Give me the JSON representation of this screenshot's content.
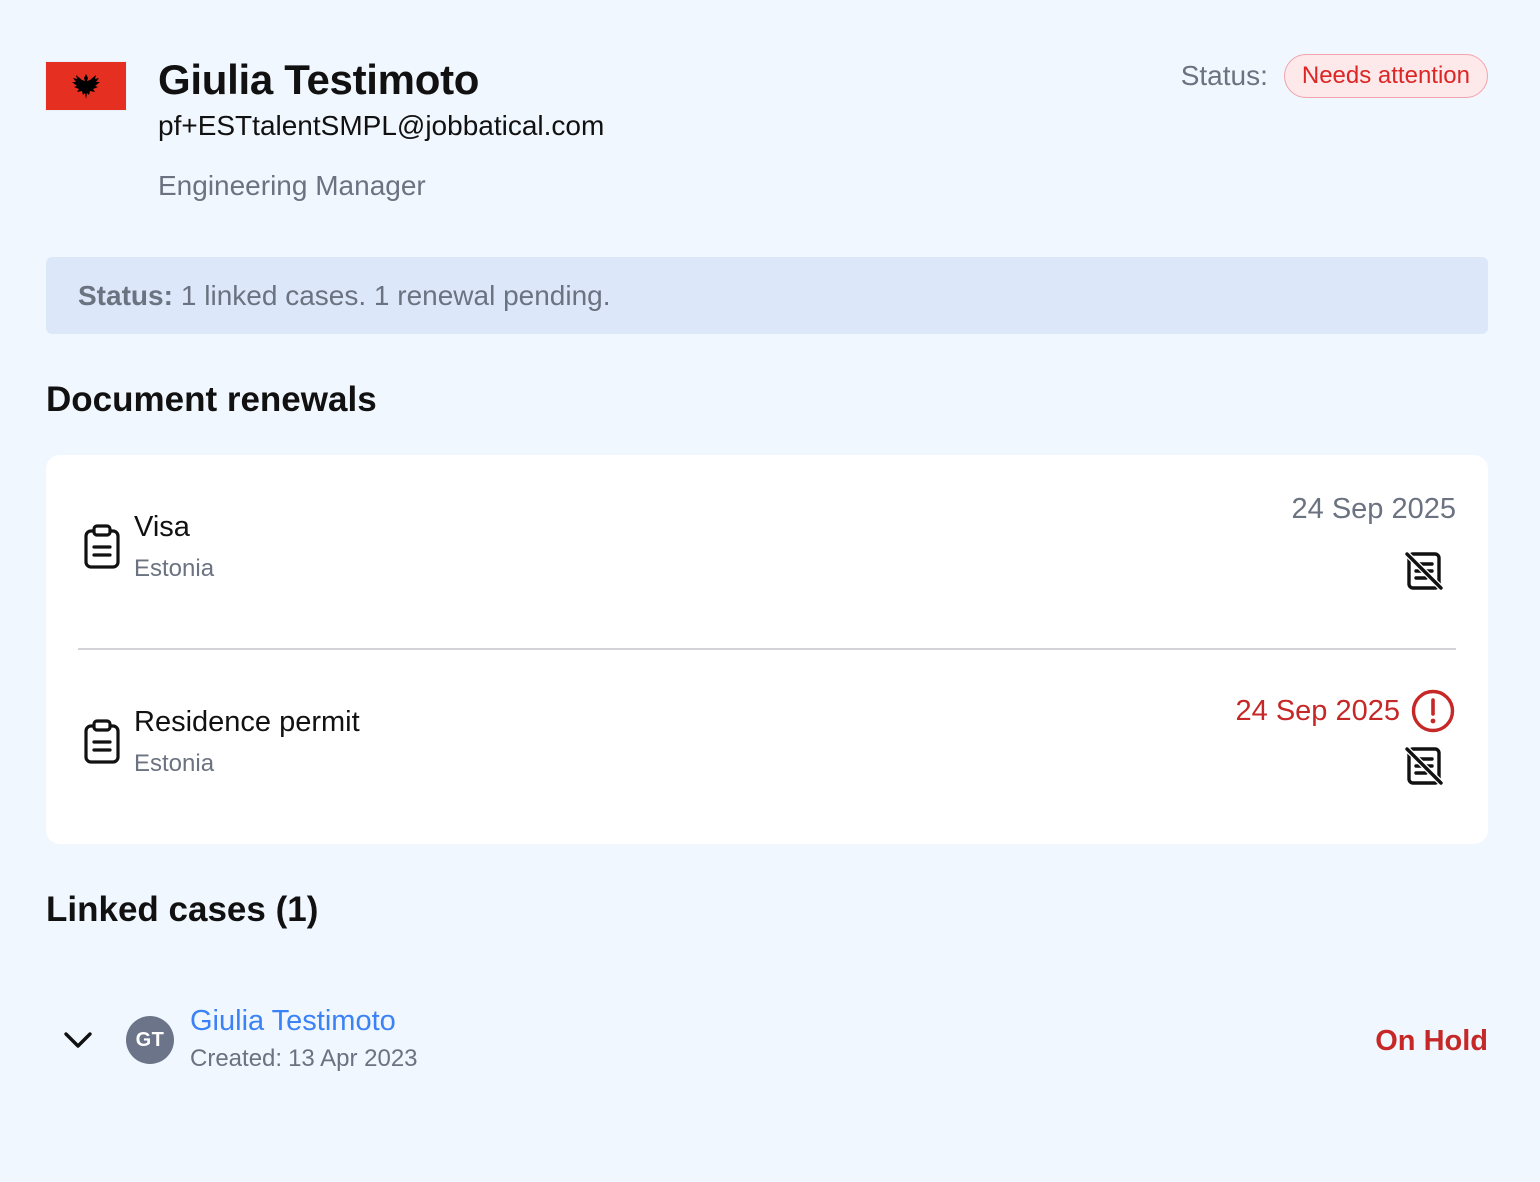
{
  "profile": {
    "name": "Giulia Testimoto",
    "email": "pf+ESTtalentSMPL@jobbatical.com",
    "role": "Engineering Manager",
    "flag_country": "Albania",
    "status_label": "Status:",
    "status_value": "Needs attention"
  },
  "summary": {
    "label": "Status:",
    "text": "1 linked cases. 1 renewal pending."
  },
  "renewals": {
    "title": "Document renewals",
    "items": [
      {
        "title": "Visa",
        "country": "Estonia",
        "date": "24 Sep 2025",
        "alert": false,
        "icon": "clipboard-icon",
        "action_icon": "no-document-icon"
      },
      {
        "title": "Residence permit",
        "country": "Estonia",
        "date": "24 Sep 2025",
        "alert": true,
        "icon": "clipboard-icon",
        "action_icon": "no-document-icon"
      }
    ]
  },
  "linked_cases": {
    "title": "Linked cases (1)",
    "items": [
      {
        "initials": "GT",
        "name": "Giulia Testimoto",
        "created_label": "Created:",
        "created_date": "13 Apr 2023",
        "status": "On Hold"
      }
    ]
  },
  "colors": {
    "background": "#f1f7fe",
    "accent_link": "#3b82f6",
    "danger": "#c62828",
    "pill_bg": "#fde8ea",
    "summary_bg": "#dce8fa"
  }
}
